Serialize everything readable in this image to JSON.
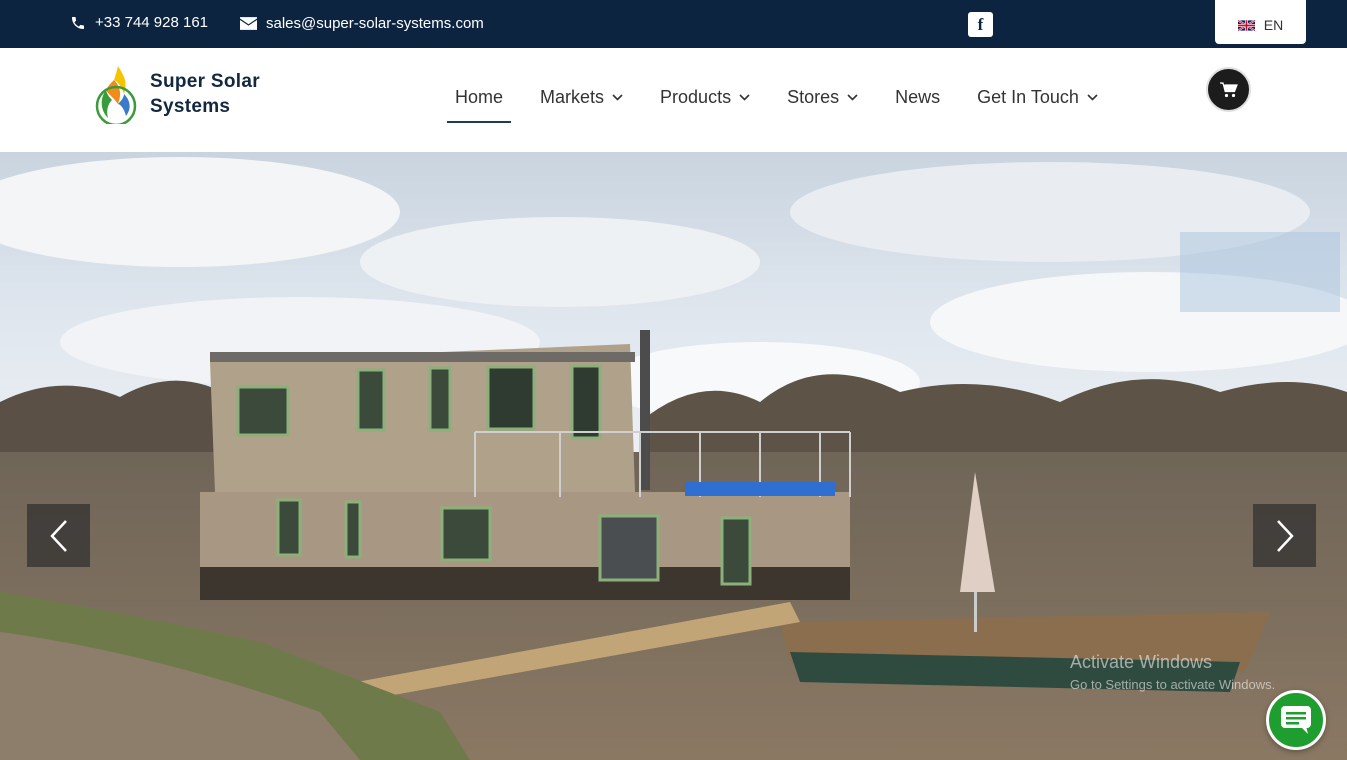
{
  "topbar": {
    "phone": "+33 744 928 161",
    "email": "sales@super-solar-systems.com",
    "social_icon": "facebook-icon",
    "language": "EN"
  },
  "brand": {
    "line1": "Super Solar",
    "line2": "Systems"
  },
  "nav": {
    "items": [
      {
        "label": "Home",
        "active": true,
        "dropdown": false
      },
      {
        "label": "Markets",
        "active": false,
        "dropdown": true
      },
      {
        "label": "Products",
        "active": false,
        "dropdown": true
      },
      {
        "label": "Stores",
        "active": false,
        "dropdown": true
      },
      {
        "label": "News",
        "active": false,
        "dropdown": false
      },
      {
        "label": "Get In Touch",
        "active": false,
        "dropdown": true
      }
    ],
    "cart_icon": "cart-icon"
  },
  "slider": {
    "prev_icon": "chevron-left-icon",
    "next_icon": "chevron-right-icon"
  },
  "watermark": {
    "line1": "Activate Windows",
    "line2": "Go to Settings to activate Windows."
  },
  "chat": {
    "icon": "chat-icon"
  },
  "colors": {
    "topbar_bg": "#0c2440",
    "brand_text": "#12283f",
    "chat_green": "#1e9e2e"
  }
}
